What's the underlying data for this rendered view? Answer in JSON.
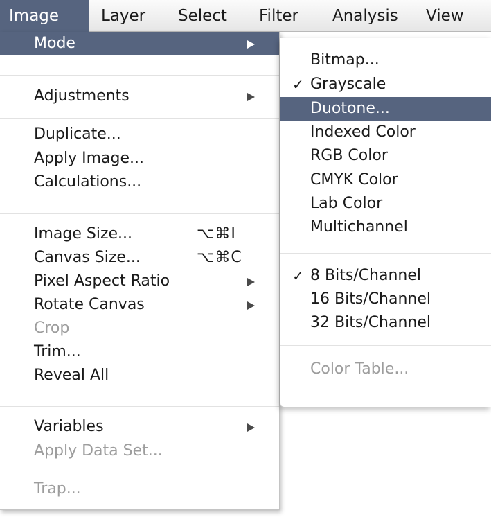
{
  "menubar": {
    "items": [
      {
        "label": "Image",
        "active": true
      },
      {
        "label": "Layer",
        "active": false
      },
      {
        "label": "Select",
        "active": false
      },
      {
        "label": "Filter",
        "active": false
      },
      {
        "label": "Analysis",
        "active": false
      },
      {
        "label": "View",
        "active": false
      }
    ]
  },
  "image_menu": {
    "items": [
      {
        "label": "Mode",
        "submenu": true,
        "highlighted": true
      },
      {
        "label": "Adjustments",
        "submenu": true
      },
      {
        "label": "Duplicate..."
      },
      {
        "label": "Apply Image..."
      },
      {
        "label": "Calculations..."
      },
      {
        "label": "Image Size...",
        "shortcut": "⌥⌘I"
      },
      {
        "label": "Canvas Size...",
        "shortcut": "⌥⌘C"
      },
      {
        "label": "Pixel Aspect Ratio",
        "submenu": true
      },
      {
        "label": "Rotate Canvas",
        "submenu": true
      },
      {
        "label": "Crop",
        "disabled": true
      },
      {
        "label": "Trim..."
      },
      {
        "label": "Reveal All"
      },
      {
        "label": "Variables",
        "submenu": true
      },
      {
        "label": "Apply Data Set...",
        "disabled": true
      },
      {
        "label": "Trap...",
        "disabled": true
      }
    ]
  },
  "mode_submenu": {
    "check_mark": "✓",
    "items": [
      {
        "label": "Bitmap..."
      },
      {
        "label": "Grayscale",
        "checked": true
      },
      {
        "label": "Duotone...",
        "highlighted": true
      },
      {
        "label": "Indexed Color"
      },
      {
        "label": "RGB Color"
      },
      {
        "label": "CMYK Color"
      },
      {
        "label": "Lab Color"
      },
      {
        "label": "Multichannel"
      },
      {
        "label": "8 Bits/Channel",
        "checked": true
      },
      {
        "label": "16 Bits/Channel"
      },
      {
        "label": "32 Bits/Channel"
      },
      {
        "label": "Color Table...",
        "disabled": true
      }
    ]
  },
  "colors": {
    "highlight": "#56647f",
    "disabled_text": "#9d9d9d",
    "text": "#1a1a1a"
  }
}
